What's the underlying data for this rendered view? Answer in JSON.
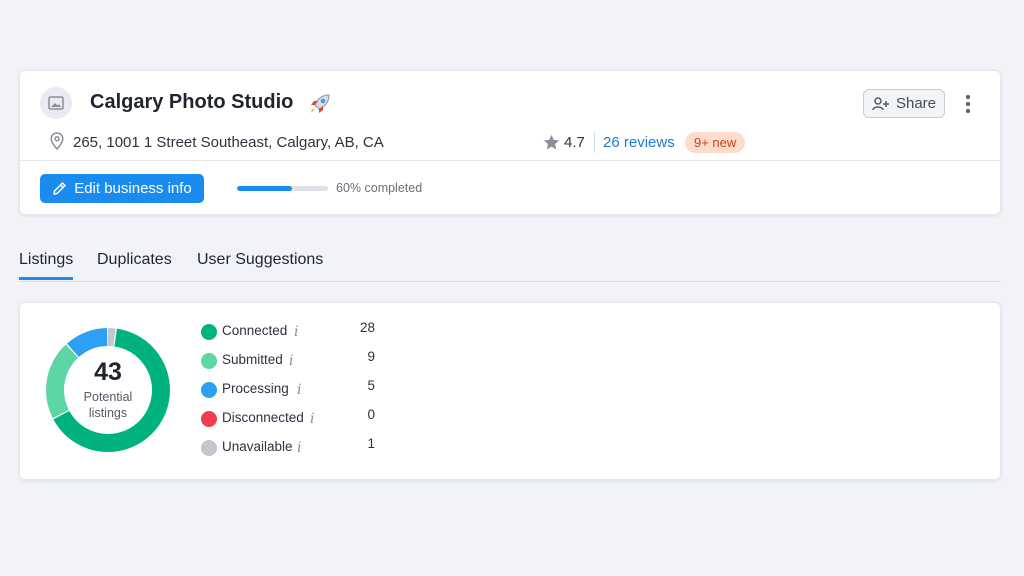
{
  "business": {
    "name": "Calgary Photo Studio",
    "address": "265, 1001 1 Street Southeast, Calgary, AB, CA",
    "rating": "4.7",
    "reviews_link": "26 reviews",
    "new_badge": "9+ new",
    "share_label": "Share",
    "edit_label": "Edit business info",
    "progress_percent": 60,
    "progress_label": "60% completed"
  },
  "tabs": [
    {
      "label": "Listings",
      "active": true
    },
    {
      "label": "Duplicates",
      "active": false
    },
    {
      "label": "User Suggestions",
      "active": false
    }
  ],
  "listings": {
    "total": "43",
    "caption_line1": "Potential",
    "caption_line2": "listings",
    "statuses": [
      {
        "label": "Connected",
        "value": 28,
        "color": "#00b37e"
      },
      {
        "label": "Submitted",
        "value": 9,
        "color": "#5cd6a4"
      },
      {
        "label": "Processing",
        "value": 5,
        "color": "#2d9ff5"
      },
      {
        "label": "Disconnected",
        "value": 0,
        "color": "#f03e4f"
      },
      {
        "label": "Unavailable",
        "value": 1,
        "color": "#c4c7cf"
      }
    ]
  },
  "colors": {
    "accent": "#1a8cf0",
    "badge_bg": "#fddccc",
    "badge_text": "#c7461a"
  },
  "icons": {
    "thumb": "image-icon",
    "rocket": "rocket-icon",
    "share": "add-user-icon",
    "more": "more-vertical-icon",
    "location": "map-pin-icon",
    "star": "star-icon",
    "edit": "pencil-icon",
    "info": "info-icon"
  }
}
